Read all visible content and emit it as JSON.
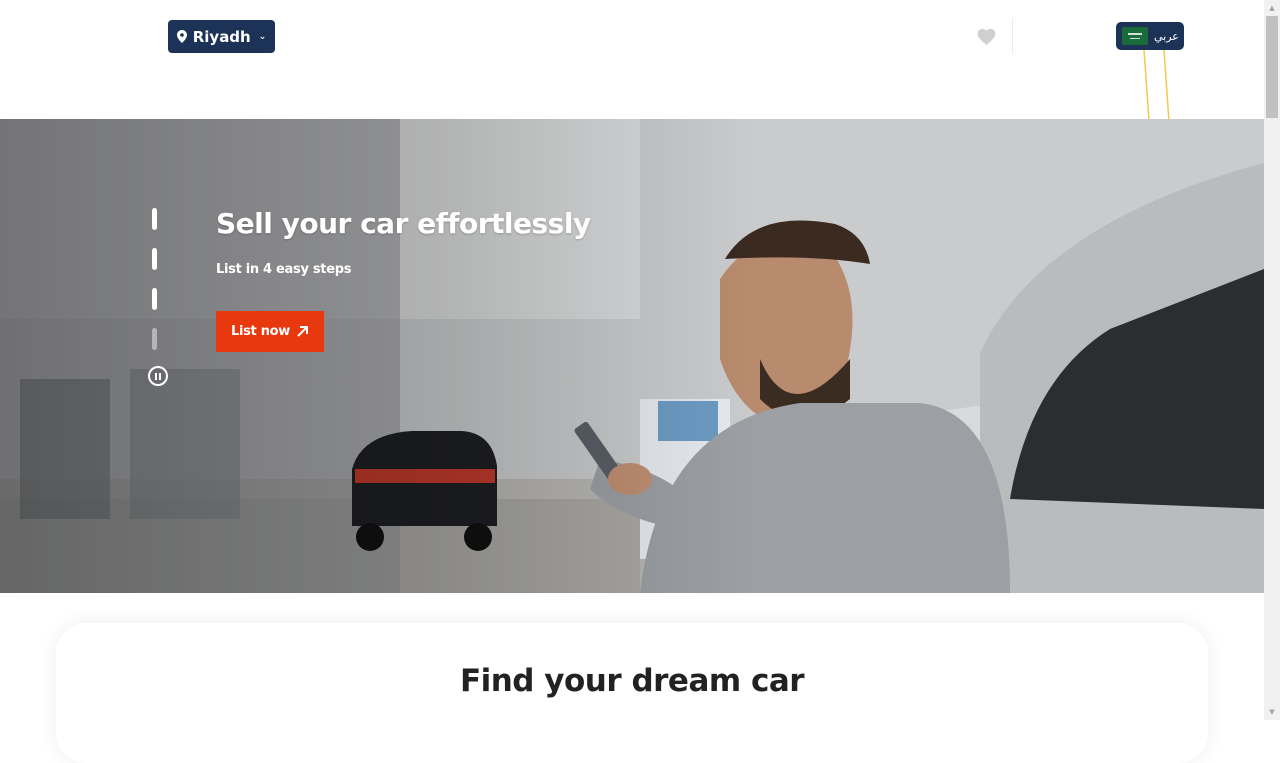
{
  "header": {
    "city": "Riyadh",
    "language_label": "عربي",
    "icons": {
      "location": "map-pin-icon",
      "dropdown": "chevron-down-icon",
      "favorites": "heart-icon",
      "flag": "saudi-flag-icon"
    },
    "colors": {
      "brand_navy": "#1c3357",
      "favorites_icon": "#cfcfcf"
    }
  },
  "hero": {
    "title": "Sell your car effortlessly",
    "subtitle": "List in 4 easy steps",
    "cta_label": "List now",
    "cta_icon": "arrow-up-right-icon",
    "slides_count": 4,
    "active_slide": 4,
    "pause_icon": "pause-icon",
    "colors": {
      "cta": "#e8380d"
    }
  },
  "search": {
    "title": "Find your dream car"
  },
  "scrollbar": {
    "up_arrow": "▲",
    "down_arrow": "▼"
  }
}
